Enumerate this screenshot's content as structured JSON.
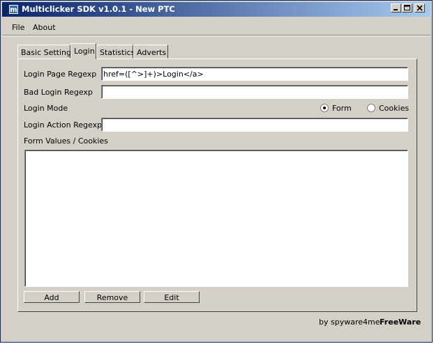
{
  "window": {
    "title": "Multiclicker SDK v1.0.1 - New PTC",
    "app_icon_letter": "m",
    "buttons": [
      "minimize",
      "maximize",
      "close"
    ]
  },
  "menu": {
    "items": [
      "File",
      "About"
    ]
  },
  "tabs": [
    {
      "label": "Basic Settings",
      "active": false
    },
    {
      "label": "Login",
      "active": true
    },
    {
      "label": "Statistics",
      "active": false
    },
    {
      "label": "Adverts",
      "active": false
    }
  ],
  "login": {
    "page_regexp_label": "Login Page Regexp",
    "page_regexp_value": "href=([^>]+)>Login</a>",
    "bad_login_label": "Bad Login Regexp",
    "bad_login_value": "",
    "mode_label": "Login Mode",
    "mode_options": [
      {
        "label": "Form",
        "selected": true
      },
      {
        "label": "Cookies",
        "selected": false
      }
    ],
    "action_regexp_label": "Login Action Regexp",
    "action_regexp_value": "",
    "form_values_label": "Form Values / Cookies"
  },
  "actions": {
    "add_label": "Add",
    "remove_label": "Remove",
    "edit_label": "Edit"
  },
  "footer": {
    "by_text": "by spyware4me",
    "freeware_text": "FreeWare"
  },
  "colors": {
    "titlebar_start": "#0a246a",
    "titlebar_end": "#a6caf0",
    "face": "#d4d0c8"
  }
}
